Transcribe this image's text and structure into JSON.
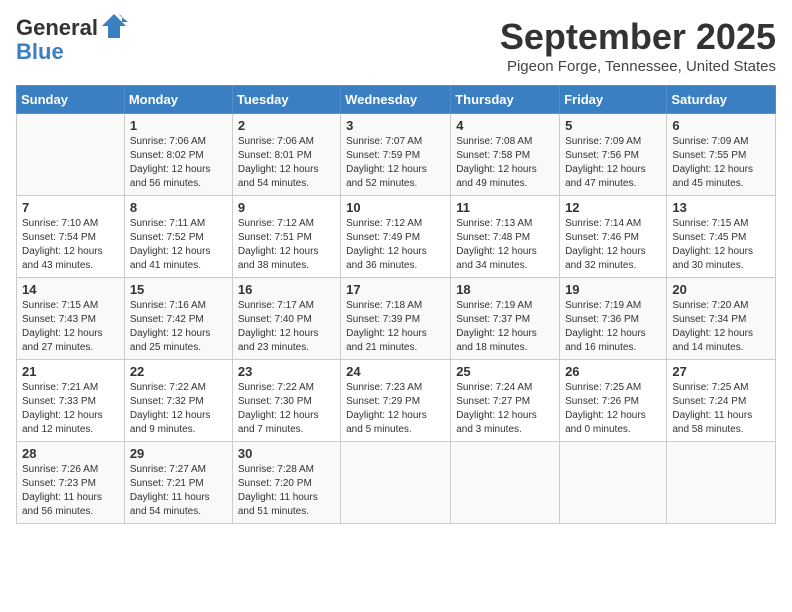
{
  "header": {
    "logo_general": "General",
    "logo_blue": "Blue",
    "month_title": "September 2025",
    "subtitle": "Pigeon Forge, Tennessee, United States"
  },
  "days_of_week": [
    "Sunday",
    "Monday",
    "Tuesday",
    "Wednesday",
    "Thursday",
    "Friday",
    "Saturday"
  ],
  "weeks": [
    [
      {
        "num": "",
        "info": ""
      },
      {
        "num": "1",
        "info": "Sunrise: 7:06 AM\nSunset: 8:02 PM\nDaylight: 12 hours and 56 minutes."
      },
      {
        "num": "2",
        "info": "Sunrise: 7:06 AM\nSunset: 8:01 PM\nDaylight: 12 hours and 54 minutes."
      },
      {
        "num": "3",
        "info": "Sunrise: 7:07 AM\nSunset: 7:59 PM\nDaylight: 12 hours and 52 minutes."
      },
      {
        "num": "4",
        "info": "Sunrise: 7:08 AM\nSunset: 7:58 PM\nDaylight: 12 hours and 49 minutes."
      },
      {
        "num": "5",
        "info": "Sunrise: 7:09 AM\nSunset: 7:56 PM\nDaylight: 12 hours and 47 minutes."
      },
      {
        "num": "6",
        "info": "Sunrise: 7:09 AM\nSunset: 7:55 PM\nDaylight: 12 hours and 45 minutes."
      }
    ],
    [
      {
        "num": "7",
        "info": "Sunrise: 7:10 AM\nSunset: 7:54 PM\nDaylight: 12 hours and 43 minutes."
      },
      {
        "num": "8",
        "info": "Sunrise: 7:11 AM\nSunset: 7:52 PM\nDaylight: 12 hours and 41 minutes."
      },
      {
        "num": "9",
        "info": "Sunrise: 7:12 AM\nSunset: 7:51 PM\nDaylight: 12 hours and 38 minutes."
      },
      {
        "num": "10",
        "info": "Sunrise: 7:12 AM\nSunset: 7:49 PM\nDaylight: 12 hours and 36 minutes."
      },
      {
        "num": "11",
        "info": "Sunrise: 7:13 AM\nSunset: 7:48 PM\nDaylight: 12 hours and 34 minutes."
      },
      {
        "num": "12",
        "info": "Sunrise: 7:14 AM\nSunset: 7:46 PM\nDaylight: 12 hours and 32 minutes."
      },
      {
        "num": "13",
        "info": "Sunrise: 7:15 AM\nSunset: 7:45 PM\nDaylight: 12 hours and 30 minutes."
      }
    ],
    [
      {
        "num": "14",
        "info": "Sunrise: 7:15 AM\nSunset: 7:43 PM\nDaylight: 12 hours and 27 minutes."
      },
      {
        "num": "15",
        "info": "Sunrise: 7:16 AM\nSunset: 7:42 PM\nDaylight: 12 hours and 25 minutes."
      },
      {
        "num": "16",
        "info": "Sunrise: 7:17 AM\nSunset: 7:40 PM\nDaylight: 12 hours and 23 minutes."
      },
      {
        "num": "17",
        "info": "Sunrise: 7:18 AM\nSunset: 7:39 PM\nDaylight: 12 hours and 21 minutes."
      },
      {
        "num": "18",
        "info": "Sunrise: 7:19 AM\nSunset: 7:37 PM\nDaylight: 12 hours and 18 minutes."
      },
      {
        "num": "19",
        "info": "Sunrise: 7:19 AM\nSunset: 7:36 PM\nDaylight: 12 hours and 16 minutes."
      },
      {
        "num": "20",
        "info": "Sunrise: 7:20 AM\nSunset: 7:34 PM\nDaylight: 12 hours and 14 minutes."
      }
    ],
    [
      {
        "num": "21",
        "info": "Sunrise: 7:21 AM\nSunset: 7:33 PM\nDaylight: 12 hours and 12 minutes."
      },
      {
        "num": "22",
        "info": "Sunrise: 7:22 AM\nSunset: 7:32 PM\nDaylight: 12 hours and 9 minutes."
      },
      {
        "num": "23",
        "info": "Sunrise: 7:22 AM\nSunset: 7:30 PM\nDaylight: 12 hours and 7 minutes."
      },
      {
        "num": "24",
        "info": "Sunrise: 7:23 AM\nSunset: 7:29 PM\nDaylight: 12 hours and 5 minutes."
      },
      {
        "num": "25",
        "info": "Sunrise: 7:24 AM\nSunset: 7:27 PM\nDaylight: 12 hours and 3 minutes."
      },
      {
        "num": "26",
        "info": "Sunrise: 7:25 AM\nSunset: 7:26 PM\nDaylight: 12 hours and 0 minutes."
      },
      {
        "num": "27",
        "info": "Sunrise: 7:25 AM\nSunset: 7:24 PM\nDaylight: 11 hours and 58 minutes."
      }
    ],
    [
      {
        "num": "28",
        "info": "Sunrise: 7:26 AM\nSunset: 7:23 PM\nDaylight: 11 hours and 56 minutes."
      },
      {
        "num": "29",
        "info": "Sunrise: 7:27 AM\nSunset: 7:21 PM\nDaylight: 11 hours and 54 minutes."
      },
      {
        "num": "30",
        "info": "Sunrise: 7:28 AM\nSunset: 7:20 PM\nDaylight: 11 hours and 51 minutes."
      },
      {
        "num": "",
        "info": ""
      },
      {
        "num": "",
        "info": ""
      },
      {
        "num": "",
        "info": ""
      },
      {
        "num": "",
        "info": ""
      }
    ]
  ]
}
